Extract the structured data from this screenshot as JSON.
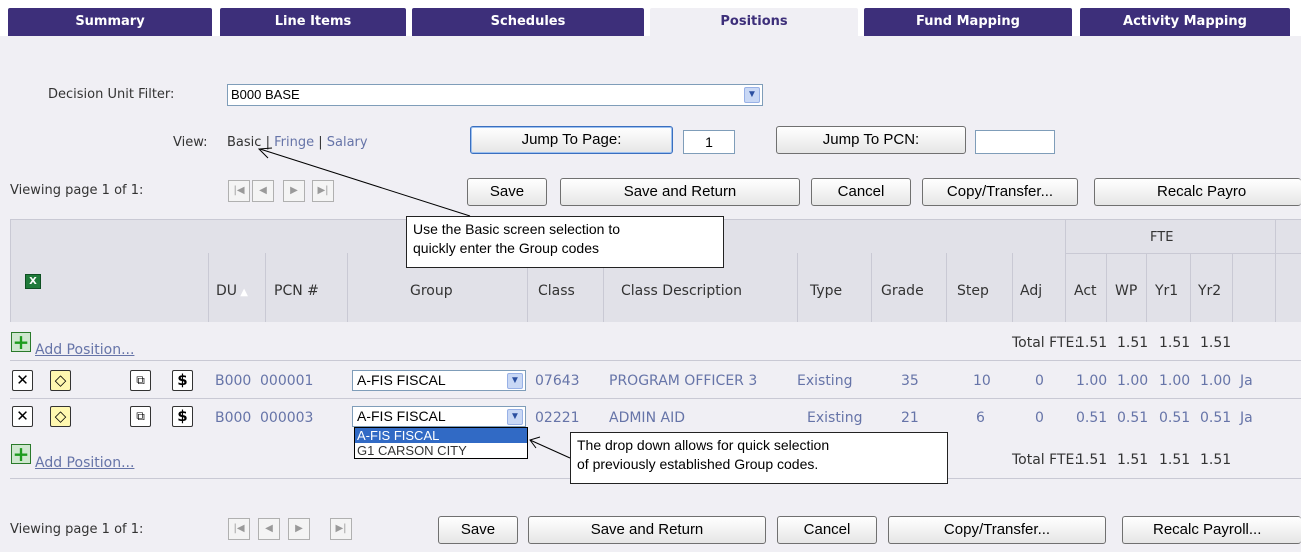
{
  "tabs": [
    "Summary",
    "Line Items",
    "Schedules",
    "Positions",
    "Fund Mapping",
    "Activity Mapping"
  ],
  "active_tab": "Positions",
  "filter": {
    "label": "Decision Unit Filter:",
    "value": "B000 BASE"
  },
  "view": {
    "label": "View:",
    "basic": "Basic",
    "sep1": "|",
    "fringe": "Fringe",
    "sep2": "|",
    "salary": "Salary"
  },
  "jump": {
    "page_button": "Jump To Page:",
    "page_value": "1",
    "pcn_button": "Jump To PCN:",
    "pcn_value": ""
  },
  "paging": {
    "label": "Viewing page 1 of 1:"
  },
  "toolbar": {
    "save": "Save",
    "save_return": "Save and Return",
    "cancel": "Cancel",
    "copy_transfer": "Copy/Transfer...",
    "recalc_top": "Recalc Payro",
    "recalc_bottom": "Recalc Payroll..."
  },
  "callouts": {
    "basic": [
      "Use the Basic screen selection to",
      "quickly enter the Group codes"
    ],
    "dropdown": [
      "The drop down allows for quick selection",
      "of previously established Group codes."
    ]
  },
  "table": {
    "fte_group": "FTE",
    "columns": [
      "DU",
      "PCN #",
      "Group",
      "Class",
      "Class Description",
      "Type",
      "Grade",
      "Step",
      "Adj",
      "Act",
      "WP",
      "Yr1",
      "Yr2"
    ],
    "add_position": "Add Position...",
    "total_label": "Total FTE:",
    "totals": [
      "1.51",
      "1.51",
      "1.51",
      "1.51"
    ],
    "rows": [
      {
        "du": "B000",
        "pcn": "000001",
        "group": "A-FIS FISCAL",
        "class": "07643",
        "description": "PROGRAM OFFICER 3",
        "type": "Existing",
        "grade": "35",
        "step": "10",
        "adj": "0",
        "act": "1.00",
        "wp": "1.00",
        "yr1": "1.00",
        "yr2": "1.00",
        "extra": "Ja"
      },
      {
        "du": "B000",
        "pcn": "000003",
        "group": "A-FIS FISCAL",
        "class": "02221",
        "description": "ADMIN AID",
        "type": "Existing",
        "grade": "21",
        "step": "6",
        "adj": "0",
        "act": "0.51",
        "wp": "0.51",
        "yr1": "0.51",
        "yr2": "0.51",
        "extra": "Ja"
      }
    ],
    "dropdown_options": [
      "A-FIS FISCAL",
      "G1 CARSON CITY"
    ]
  },
  "colors": {
    "tab_bg": "#3d2f7a",
    "content_bg": "#f0eff4",
    "link": "#6674a8",
    "selected": "#316ac5"
  }
}
